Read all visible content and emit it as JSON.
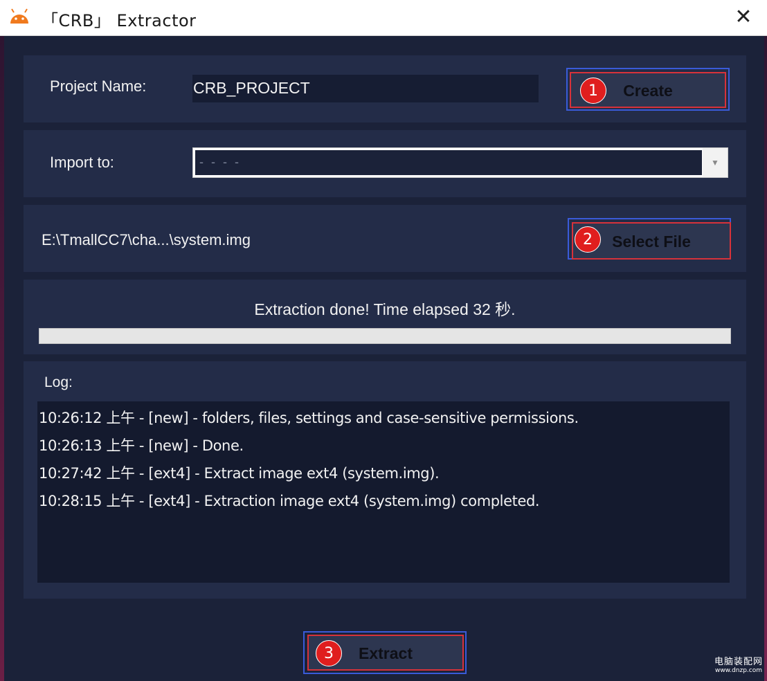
{
  "window": {
    "title": "「CRB」 Extractor"
  },
  "project": {
    "label": "Project Name:",
    "value": "CRB_PROJECT",
    "create_button": "Create",
    "create_badge": "1"
  },
  "import": {
    "label": "Import to:",
    "selected": "- - - -"
  },
  "file": {
    "path": "E:\\TmallCC7\\cha...\\system.img",
    "select_button": "Select File",
    "select_badge": "2"
  },
  "status": {
    "text": "Extraction done! Time elapsed 32 秒.",
    "progress_percent": 100
  },
  "log": {
    "label": "Log:",
    "entries": [
      "10:26:12 上午 - [new] - folders, files, settings and case-sensitive permissions.",
      "10:26:13 上午 - [new] - Done.",
      "10:27:42 上午 - [ext4] - Extract image ext4 (system.img).",
      "10:28:15 上午 - [ext4] - Extraction image ext4 (system.img) completed."
    ]
  },
  "extract": {
    "button": "Extract",
    "badge": "3"
  },
  "watermark": {
    "main": "电脑装配网",
    "sub": "www.dnzp.com"
  },
  "colors": {
    "window_bg": "#1b2239",
    "panel_bg": "#232c48",
    "highlight_blue": "#3a5bd9",
    "highlight_red": "#d8323a",
    "badge_red": "#e01e1e"
  },
  "icons": {
    "app": "android-icon",
    "close": "close-icon",
    "dropdown": "chevron-down-icon"
  }
}
